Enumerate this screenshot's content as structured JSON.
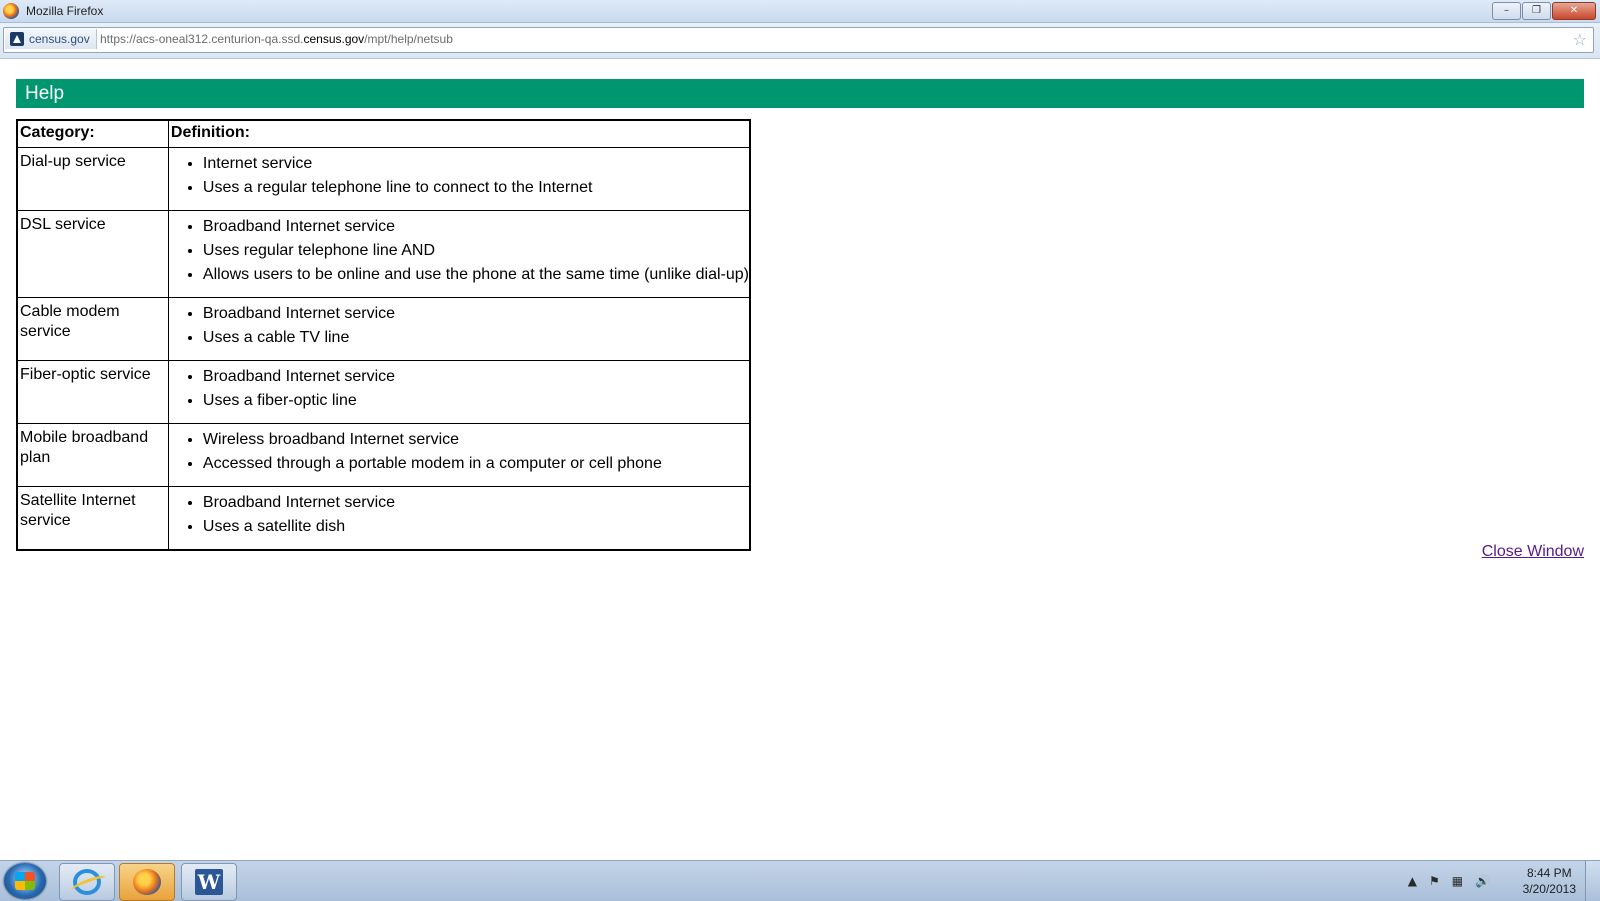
{
  "window": {
    "title": "Mozilla Firefox",
    "controls": [
      "–",
      "❐",
      "✕"
    ]
  },
  "address_bar": {
    "site_badge": "census.gov",
    "url_prefix": "https://acs-oneal312.centurion-qa.ssd.",
    "url_host": "census.gov",
    "url_path": "/mpt/help/netsub",
    "bookmark_star": "☆"
  },
  "page": {
    "header": "Help",
    "table": {
      "col_category": "Category:",
      "col_definition": "Definition:",
      "rows": [
        {
          "category": "Dial-up service",
          "items": [
            "Internet service",
            "Uses a regular telephone line to connect to the Internet"
          ]
        },
        {
          "category": "DSL service",
          "items": [
            "Broadband Internet service",
            "Uses regular telephone line AND",
            "Allows users to be online and use the phone at the same time (unlike dial-up)"
          ]
        },
        {
          "category": "Cable modem service",
          "items": [
            "Broadband Internet service",
            "Uses a cable TV line"
          ]
        },
        {
          "category": "Fiber-optic service",
          "items": [
            "Broadband Internet service",
            "Uses a fiber-optic line"
          ]
        },
        {
          "category": "Mobile broadband plan",
          "items": [
            "Wireless broadband Internet service",
            "Accessed through a portable modem in a computer or cell phone"
          ]
        },
        {
          "category": "Satellite Internet service",
          "items": [
            "Broadband Internet service",
            "Uses a satellite dish"
          ]
        }
      ]
    },
    "close_link": "Close Window"
  },
  "taskbar": {
    "word_letter": "W",
    "tray_icons": [
      "▲",
      "⚑",
      "▦",
      "🔊"
    ],
    "time": "8:44 PM",
    "date": "3/20/2013"
  },
  "colors": {
    "help_header_bg": "#009670",
    "link_visited": "#551a8b"
  }
}
